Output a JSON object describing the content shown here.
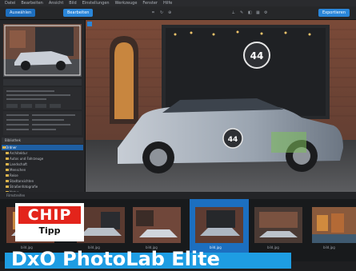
{
  "app": {
    "menu": [
      "Datei",
      "Bearbeiten",
      "Ansicht",
      "Bild",
      "Einstellungen",
      "Werkzeuge",
      "Fenster",
      "Hilfe"
    ]
  },
  "toolbar": {
    "btn_select": "Auswählen",
    "btn_edit": "Bearbeiten",
    "btn_export": "Exportieren"
  },
  "left": {
    "tree_header": "Bibliothek",
    "tree_items": [
      "Ordner",
      "Architektur",
      "Autos und Fahrzeuge",
      "Landschaft",
      "Menschen",
      "Reise",
      "Stadtansichten",
      "Straßenfotografie",
      "Natur",
      "Projekte",
      "Archiv",
      "Export",
      "Import"
    ]
  },
  "filmstrip": {
    "bar_label": "Filmstreifen",
    "thumb_labels": [
      "bild.jpg",
      "bild.jpg",
      "bild.jpg",
      "bild.jpg",
      "bild.jpg",
      "bild.jpg"
    ]
  },
  "badge": {
    "brand": "CHIP",
    "label": "Tipp"
  },
  "banner": {
    "text": "DxO PhotoLab Elite"
  },
  "colors": {
    "accent": "#2a86d9",
    "chip_red": "#e3241b",
    "banner_blue": "#1e9de3"
  }
}
